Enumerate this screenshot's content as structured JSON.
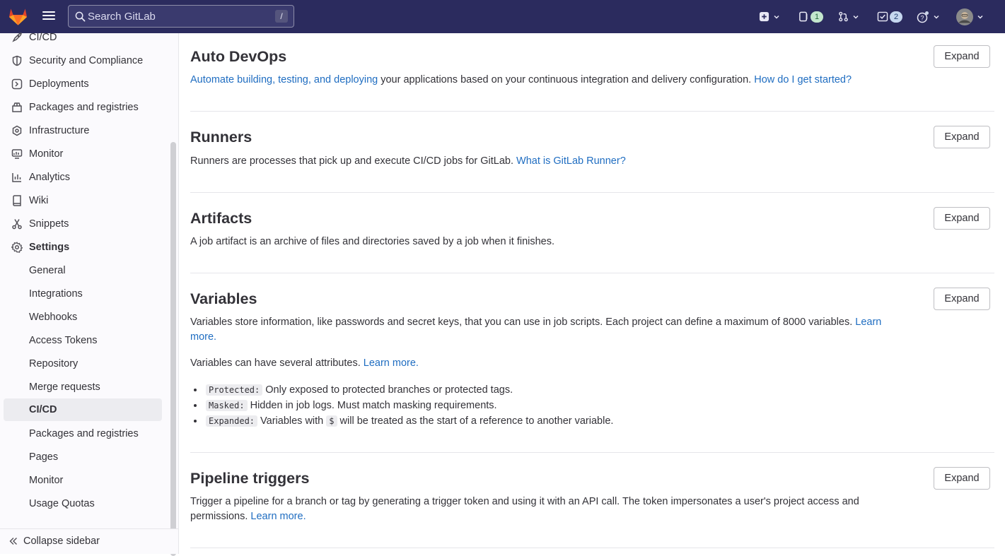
{
  "topbar": {
    "search_placeholder": "Search GitLab",
    "search_shortcut": "/",
    "issues_count": "1",
    "todos_count": "2"
  },
  "sidebar": {
    "items": [
      {
        "label": "CI/CD",
        "icon": "rocket-icon"
      },
      {
        "label": "Security and Compliance",
        "icon": "shield-icon"
      },
      {
        "label": "Deployments",
        "icon": "deployments-icon"
      },
      {
        "label": "Packages and registries",
        "icon": "package-icon"
      },
      {
        "label": "Infrastructure",
        "icon": "cloud-gear-icon"
      },
      {
        "label": "Monitor",
        "icon": "monitor-icon"
      },
      {
        "label": "Analytics",
        "icon": "chart-icon"
      },
      {
        "label": "Wiki",
        "icon": "book-icon"
      },
      {
        "label": "Snippets",
        "icon": "scissors-icon"
      },
      {
        "label": "Settings",
        "icon": "gear-icon"
      }
    ],
    "settings_sub": [
      "General",
      "Integrations",
      "Webhooks",
      "Access Tokens",
      "Repository",
      "Merge requests",
      "CI/CD",
      "Packages and registries",
      "Pages",
      "Monitor",
      "Usage Quotas"
    ],
    "active_sub": "CI/CD",
    "collapse_label": "Collapse sidebar"
  },
  "main": {
    "expand_label": "Expand",
    "auto_devops": {
      "title": "Auto DevOps",
      "link1": "Automate building, testing, and deploying",
      "text": " your applications based on your continuous integration and delivery configuration. ",
      "link2": "How do I get started?"
    },
    "runners": {
      "title": "Runners",
      "text": "Runners are processes that pick up and execute CI/CD jobs for GitLab. ",
      "link": "What is GitLab Runner?"
    },
    "artifacts": {
      "title": "Artifacts",
      "text": "A job artifact is an archive of files and directories saved by a job when it finishes."
    },
    "variables": {
      "title": "Variables",
      "text": "Variables store information, like passwords and secret keys, that you can use in job scripts. Each project can define a maximum of 8000 variables. ",
      "link": "Learn more.",
      "attrs_text": "Variables can have several attributes. ",
      "attrs_link": "Learn more.",
      "protected_code": "Protected:",
      "protected_text": " Only exposed to protected branches or protected tags.",
      "masked_code": "Masked:",
      "masked_text": " Hidden in job logs. Must match masking requirements.",
      "expanded_code": "Expanded:",
      "expanded_text1": " Variables with ",
      "expanded_dollar": "$",
      "expanded_text2": " will be treated as the start of a reference to another variable."
    },
    "pipeline_triggers": {
      "title": "Pipeline triggers",
      "text": "Trigger a pipeline for a branch or tag by generating a trigger token and using it with an API call. The token impersonates a user's project access and permissions. ",
      "link": "Learn more."
    }
  }
}
